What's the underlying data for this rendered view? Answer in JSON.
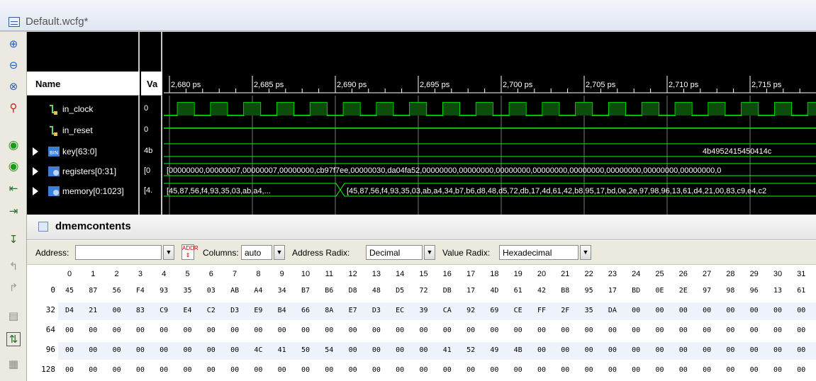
{
  "window": {
    "title": "Default.wcfg*"
  },
  "wave": {
    "name_header": "Name",
    "value_header": "Va",
    "time_labels": [
      "2,680 ps",
      "2,685 ps",
      "2,690 ps",
      "2,695 ps",
      "2,700 ps",
      "2,705 ps",
      "2,710 ps",
      "2,715 ps"
    ],
    "signals": [
      {
        "name": "in_clock",
        "value": "0"
      },
      {
        "name": "in_reset",
        "value": "0"
      },
      {
        "name": "key[63:0]",
        "value": "4b"
      },
      {
        "name": "registers[0:31]",
        "value": "[0"
      },
      {
        "name": "memory[0:1023]",
        "value": "[4."
      }
    ],
    "key_bus_text": "4b4952415450414c",
    "registers_bus_text": "[00000000,00000007,00000007,00000000,cb97f7ee,00000030,da04fa52,00000000,00000000,00000000,00000000,00000000,00000000,00000000,00000000,0",
    "memory_bus_text_1": "[45,87,56,f4,93,35,03,ab,a4,...",
    "memory_bus_text_2": "[45,87,56,f4,93,35,03,ab,a4,34,b7,b6,d8,48,d5,72,db,17,4d,61,42,b8,95,17,bd,0e,2e,97,98,96,13,61,d4,21,00,83,c9,e4,c2"
  },
  "memory_panel": {
    "title": "dmemcontents",
    "address_label": "Address:",
    "address_value": "",
    "columns_label": "Columns:",
    "columns_value": "auto",
    "address_radix_label": "Address Radix:",
    "address_radix_value": "Decimal",
    "value_radix_label": "Value Radix:",
    "value_radix_value": "Hexadecimal",
    "addr_button": "ADDR",
    "column_headers": [
      "0",
      "1",
      "2",
      "3",
      "4",
      "5",
      "6",
      "7",
      "8",
      "9",
      "10",
      "11",
      "12",
      "13",
      "14",
      "15",
      "16",
      "17",
      "18",
      "19",
      "20",
      "21",
      "22",
      "23",
      "24",
      "25",
      "26",
      "27",
      "28",
      "29",
      "30",
      "31"
    ],
    "rows": [
      {
        "address": "0",
        "cells": [
          "45",
          "87",
          "56",
          "F4",
          "93",
          "35",
          "03",
          "AB",
          "A4",
          "34",
          "B7",
          "B6",
          "D8",
          "48",
          "D5",
          "72",
          "DB",
          "17",
          "4D",
          "61",
          "42",
          "B8",
          "95",
          "17",
          "BD",
          "0E",
          "2E",
          "97",
          "98",
          "96",
          "13",
          "61"
        ]
      },
      {
        "address": "32",
        "cells": [
          "D4",
          "21",
          "00",
          "83",
          "C9",
          "E4",
          "C2",
          "D3",
          "E9",
          "B4",
          "66",
          "8A",
          "E7",
          "D3",
          "EC",
          "39",
          "CA",
          "92",
          "69",
          "CE",
          "FF",
          "2F",
          "35",
          "DA",
          "00",
          "00",
          "00",
          "00",
          "00",
          "00",
          "00",
          "00"
        ]
      },
      {
        "address": "64",
        "cells": [
          "00",
          "00",
          "00",
          "00",
          "00",
          "00",
          "00",
          "00",
          "00",
          "00",
          "00",
          "00",
          "00",
          "00",
          "00",
          "00",
          "00",
          "00",
          "00",
          "00",
          "00",
          "00",
          "00",
          "00",
          "00",
          "00",
          "00",
          "00",
          "00",
          "00",
          "00",
          "00"
        ]
      },
      {
        "address": "96",
        "cells": [
          "00",
          "00",
          "00",
          "00",
          "00",
          "00",
          "00",
          "00",
          "4C",
          "41",
          "50",
          "54",
          "00",
          "00",
          "00",
          "00",
          "41",
          "52",
          "49",
          "4B",
          "00",
          "00",
          "00",
          "00",
          "00",
          "00",
          "00",
          "00",
          "00",
          "00",
          "00",
          "00"
        ]
      },
      {
        "address": "128",
        "cells": [
          "00",
          "00",
          "00",
          "00",
          "00",
          "00",
          "00",
          "00",
          "00",
          "00",
          "00",
          "00",
          "00",
          "00",
          "00",
          "00",
          "00",
          "00",
          "00",
          "00",
          "00",
          "00",
          "00",
          "00",
          "00",
          "00",
          "00",
          "00",
          "00",
          "00",
          "00",
          "00"
        ]
      }
    ]
  },
  "colors": {
    "wave_green": "#00ff00",
    "bg": "#000000",
    "accent": "#2f6fb5"
  },
  "icons": [
    "zoom-in-icon",
    "zoom-out-icon",
    "zoom-fit-icon",
    "zoom-cursor-icon",
    "go-start-icon",
    "go-end-icon",
    "previous-transition-icon",
    "next-transition-icon",
    "add-marker-icon",
    "previous-marker-icon",
    "next-marker-icon",
    "snap-icon",
    "swap-cursors-icon",
    "layout-icon"
  ]
}
